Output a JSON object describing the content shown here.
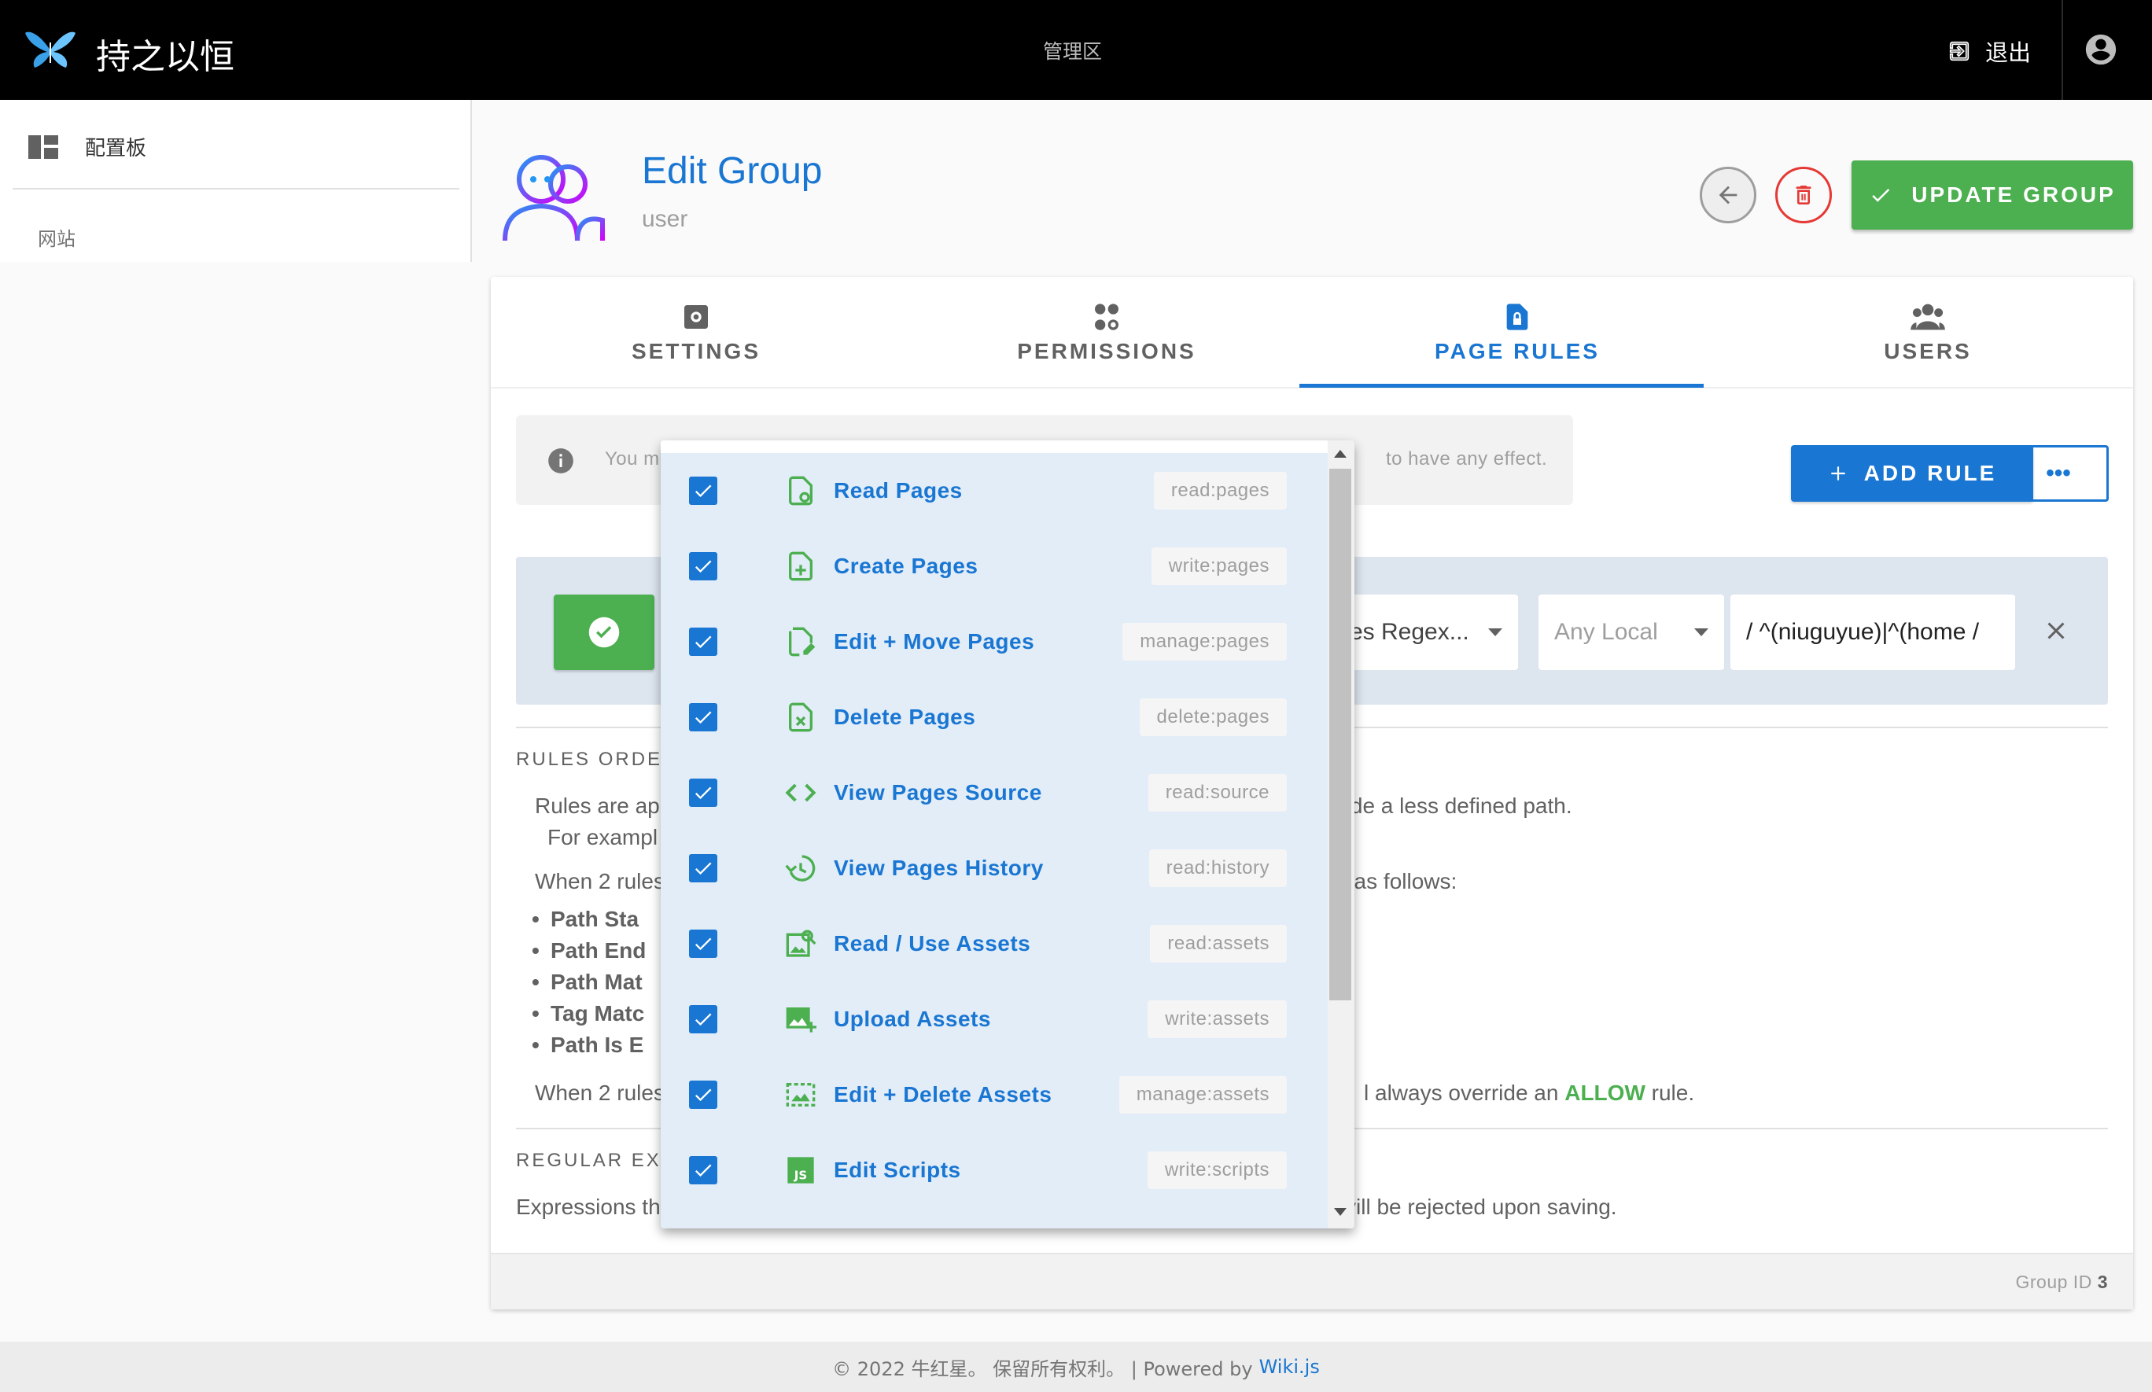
{
  "topbar": {
    "site_title": "持之以恒",
    "admin_area": "管理区",
    "logout_label": "退出"
  },
  "sidebar": {
    "dashboard_label": "配置板",
    "website_label": "网站"
  },
  "header": {
    "title": "Edit Group",
    "subtitle": "user",
    "update_label": "UPDATE GROUP"
  },
  "tabs": [
    {
      "label": "SETTINGS",
      "icon": "settings-icon"
    },
    {
      "label": "PERMISSIONS",
      "icon": "permissions-icon"
    },
    {
      "label": "PAGE RULES",
      "icon": "page-rules-icon",
      "active": true
    },
    {
      "label": "USERS",
      "icon": "users-icon"
    }
  ],
  "info": {
    "text_left": "You m",
    "text_right": "to have any effect."
  },
  "actions": {
    "add_rule_label": "ADD RULE",
    "more_label": "•••"
  },
  "rule": {
    "match_value": "es Regex...",
    "locale_value": "Any Local",
    "path_value": "/ ^(niuguyue)|^(home /"
  },
  "rules_order": {
    "heading": "RULES ORDER",
    "line1_left": "Rules are ap",
    "line1_right": "rride a less defined path.",
    "line2_left": "For exampl",
    "line3_left": "When 2 rules",
    "line3_right": "st as follows:",
    "bullets": [
      "Path Sta",
      "Path End",
      "Path Mat",
      "Tag Matc",
      "Path Is E"
    ],
    "line4_left": "When 2 rules",
    "line4_right_a": "l always override an",
    "line4_allow": "ALLOW",
    "line4_right_b": "rule."
  },
  "regex": {
    "heading": "REGULAR EXP",
    "line_left": "Expressions th",
    "line_right": "vill be rejected upon saving."
  },
  "group_id": {
    "label": "Group ID",
    "value": "3"
  },
  "footer": {
    "text": "© 2022 牛红星。 保留所有权利。 | Powered by",
    "link": "Wiki.js"
  },
  "dropdown": {
    "items": [
      {
        "label": "Read Pages",
        "scope": "read:pages",
        "icon": "file-eye-icon",
        "checked": true
      },
      {
        "label": "Create Pages",
        "scope": "write:pages",
        "icon": "file-plus-icon",
        "checked": true
      },
      {
        "label": "Edit + Move Pages",
        "scope": "manage:pages",
        "icon": "file-edit-icon",
        "checked": true
      },
      {
        "label": "Delete Pages",
        "scope": "delete:pages",
        "icon": "file-remove-icon",
        "checked": true
      },
      {
        "label": "View Pages Source",
        "scope": "read:source",
        "icon": "code-icon",
        "checked": true
      },
      {
        "label": "View Pages History",
        "scope": "read:history",
        "icon": "history-icon",
        "checked": true
      },
      {
        "label": "Read / Use Assets",
        "scope": "read:assets",
        "icon": "image-search-icon",
        "checked": true
      },
      {
        "label": "Upload Assets",
        "scope": "write:assets",
        "icon": "image-plus-icon",
        "checked": true
      },
      {
        "label": "Edit + Delete Assets",
        "scope": "manage:assets",
        "icon": "image-edit-icon",
        "checked": true
      },
      {
        "label": "Edit Scripts",
        "scope": "write:scripts",
        "icon": "js-icon",
        "checked": true
      }
    ]
  },
  "colors": {
    "brand_blue": "#1976d2",
    "success_green": "#4caf50",
    "danger_red": "#e53935",
    "topbar_black": "#000000"
  }
}
